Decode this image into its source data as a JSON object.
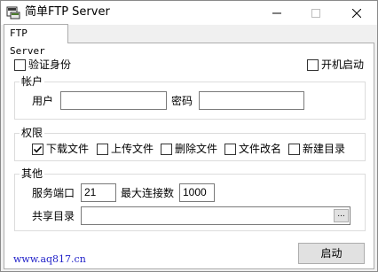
{
  "window": {
    "title": "简单FTP Server",
    "footer_link": "www.aq817.cn"
  },
  "tabs": [
    {
      "label": "FTP Server",
      "selected": true
    }
  ],
  "top_options": {
    "auth": {
      "label": "验证身份",
      "checked": false
    },
    "autostart": {
      "label": "开机启动",
      "checked": false
    }
  },
  "account": {
    "title": "帐户",
    "user_label": "用户",
    "user_value": "",
    "password_label": "密码",
    "password_value": ""
  },
  "permissions": {
    "title": "权限",
    "items": [
      {
        "label": "下载文件",
        "checked": true
      },
      {
        "label": "上传文件",
        "checked": false
      },
      {
        "label": "删除文件",
        "checked": false
      },
      {
        "label": "文件改名",
        "checked": false
      },
      {
        "label": "新建目录",
        "checked": false
      }
    ]
  },
  "other": {
    "title": "其他",
    "port_label": "服务端口",
    "port_value": "21",
    "max_conn_label": "最大连接数",
    "max_conn_value": "1000",
    "share_dir_label": "共享目录",
    "share_dir_value": "",
    "browse_label": "..."
  },
  "actions": {
    "start_label": "启动"
  }
}
